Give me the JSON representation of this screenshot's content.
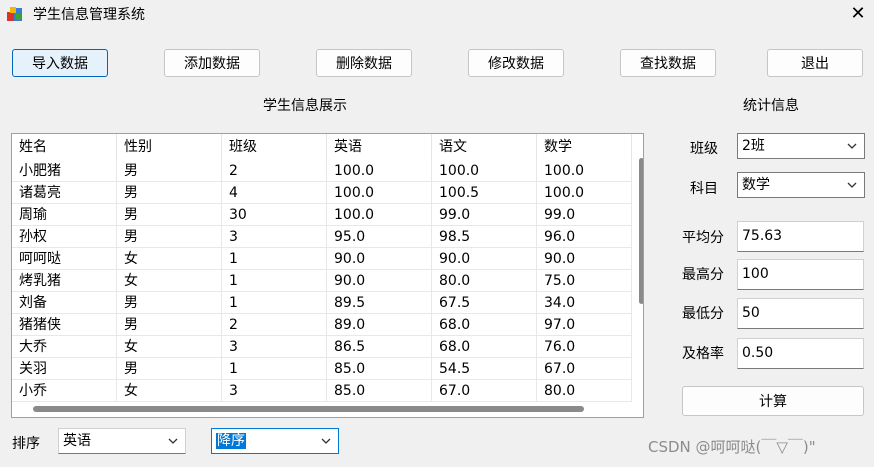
{
  "window": {
    "title": "学生信息管理系统",
    "close_glyph": "✕"
  },
  "toolbar": {
    "import_label": "导入数据",
    "add_label": "添加数据",
    "delete_label": "删除数据",
    "modify_label": "修改数据",
    "find_label": "查找数据",
    "exit_label": "退出"
  },
  "sections": {
    "display_title": "学生信息展示",
    "stats_title": "统计信息"
  },
  "table": {
    "columns": [
      "姓名",
      "性别",
      "班级",
      "英语",
      "语文",
      "数学"
    ],
    "rows": [
      [
        "小肥猪",
        "男",
        "2",
        "100.0",
        "100.0",
        "100.0"
      ],
      [
        "诸葛亮",
        "男",
        "4",
        "100.0",
        "100.5",
        "100.0"
      ],
      [
        "周瑜",
        "男",
        "30",
        "100.0",
        "99.0",
        "99.0"
      ],
      [
        "孙权",
        "男",
        "3",
        "95.0",
        "98.5",
        "96.0"
      ],
      [
        "呵呵哒",
        "女",
        "1",
        "90.0",
        "90.0",
        "90.0"
      ],
      [
        "烤乳猪",
        "女",
        "1",
        "90.0",
        "80.0",
        "75.0"
      ],
      [
        "刘备",
        "男",
        "1",
        "89.5",
        "67.5",
        "34.0"
      ],
      [
        "猪猪侠",
        "男",
        "2",
        "89.0",
        "68.0",
        "97.0"
      ],
      [
        "大乔",
        "女",
        "3",
        "86.5",
        "68.0",
        "76.0"
      ],
      [
        "关羽",
        "男",
        "1",
        "85.0",
        "54.5",
        "67.0"
      ],
      [
        "小乔",
        "女",
        "3",
        "85.0",
        "67.0",
        "80.0"
      ]
    ]
  },
  "stats": {
    "class_label": "班级",
    "class_value": "2班",
    "subject_label": "科目",
    "subject_value": "数学",
    "avg_label": "平均分",
    "avg_value": "75.63",
    "max_label": "最高分",
    "max_value": "100",
    "min_label": "最低分",
    "min_value": "50",
    "pass_label": "及格率",
    "pass_value": "0.50",
    "calc_label": "计算"
  },
  "sort": {
    "label": "排序",
    "field_value": "英语",
    "order_value": "降序"
  },
  "watermark": "CSDN @呵呵哒(￣▽￣)\"",
  "colors": {
    "accent": "#0078d7",
    "button_border_active": "#0067c0"
  }
}
